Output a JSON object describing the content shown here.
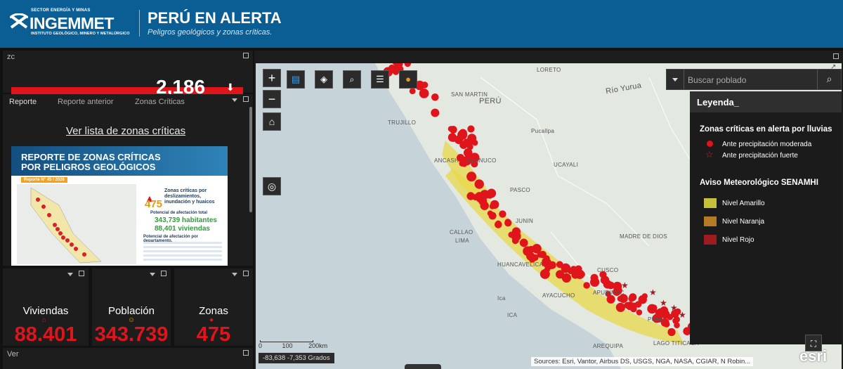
{
  "header": {
    "logo_tag": "SECTOR ENERGÍA Y MINAS",
    "logo_name": "INGEMMET",
    "logo_sub": "INSTITUTO GEOLÓGICO, MINERO Y METALÚRGICO",
    "title": "PERÚ EN ALERTA",
    "subtitle": "Peligros geológicos y zonas críticas."
  },
  "zc_panel": {
    "title": "zc",
    "value": "2,186"
  },
  "tabs": {
    "items": [
      "Reporte",
      "Reporte anterior",
      "Zonas Críticas"
    ],
    "link": "Ver lista de zonas críticas",
    "report": {
      "title_line1": "REPORTE DE ZONAS CRÍTICAS",
      "title_line2": "POR PELIGROS GEOLÓGICOS",
      "badge": "Reporte N° 45 / 2026",
      "count": "475",
      "count_caption": "Zonas críticas por deslizamientos, inundación y huaicos",
      "potential_caption": "Potencial de afectación total",
      "habitantes": "343,739 habitantes",
      "viviendas": "88,401 viviendas",
      "dept_caption": "Potencial de afectación por departamento."
    }
  },
  "stats": [
    {
      "label": "Viviendas",
      "value": "88.401",
      "icon": "house-icon"
    },
    {
      "label": "Población",
      "value": "343.739",
      "icon": "people-icon"
    },
    {
      "label": "Zonas",
      "value": "475",
      "icon": "dot-icon"
    }
  ],
  "bottom_panel": {
    "title": "Ver"
  },
  "map": {
    "search_placeholder": "Buscar poblado",
    "legend": {
      "title": "Leyenda_",
      "group1": "Zonas críticas en alerta por lluvias",
      "item_moderada": "Ante precipitación moderada",
      "item_fuerte": "Ante precipitación fuerte",
      "group2": "Aviso Meteorológico SENAMHI",
      "nivel_amarillo": "Nivel Amarillo",
      "nivel_naranja": "Nivel Naranja",
      "nivel_rojo": "Nivel Rojo"
    },
    "scale_labels": [
      "0",
      "100",
      "200km"
    ],
    "coordinates": "-83,638 -7,353 Grados",
    "attribution": "Sources: Esri, Vantor, Airbus DS, USGS, NGA, NASA, CGIAR, N Robin...",
    "esri": "esri",
    "places": [
      "LORETO",
      "Río Yurua",
      "SAN MARTIN",
      "PERÚ",
      "TRUJILLO",
      "Pucallpa",
      "UCAYALI",
      "ANCASH",
      "HUANUCO",
      "PASCO",
      "CALLAO",
      "LIMA",
      "JUNIN",
      "MADRE DE DIOS",
      "HUANCAVELICA",
      "CUSCO",
      "AYACUCHO",
      "APURIMAC",
      "Ica",
      "ICA",
      "PUNO",
      "AREQUIPA",
      "LAGO TITICACA"
    ]
  },
  "colors": {
    "header": "#0b5e93",
    "red": "#e0141b",
    "yellow": "#d8cf3a"
  }
}
